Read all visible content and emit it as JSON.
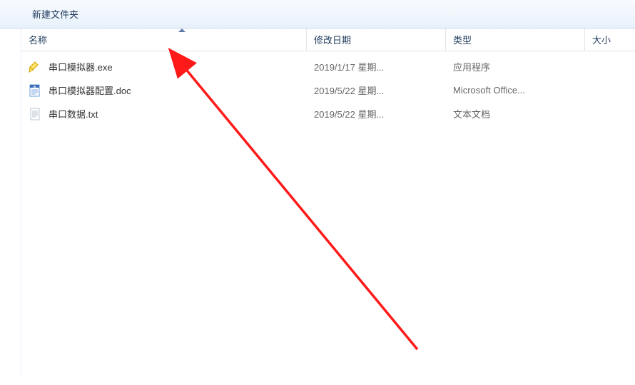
{
  "toolbar": {
    "breadcrumb": "新建文件夹"
  },
  "columns": {
    "name": "名称",
    "date": "修改日期",
    "type": "类型",
    "size": "大小"
  },
  "files": [
    {
      "icon": "exe",
      "name": "串口模拟器.exe",
      "date": "2019/1/17 星期...",
      "type": "应用程序"
    },
    {
      "icon": "doc",
      "name": "串口模拟器配置.doc",
      "date": "2019/5/22 星期...",
      "type": "Microsoft Office..."
    },
    {
      "icon": "txt",
      "name": "串口数据.txt",
      "date": "2019/5/22 星期...",
      "type": "文本文档"
    }
  ]
}
